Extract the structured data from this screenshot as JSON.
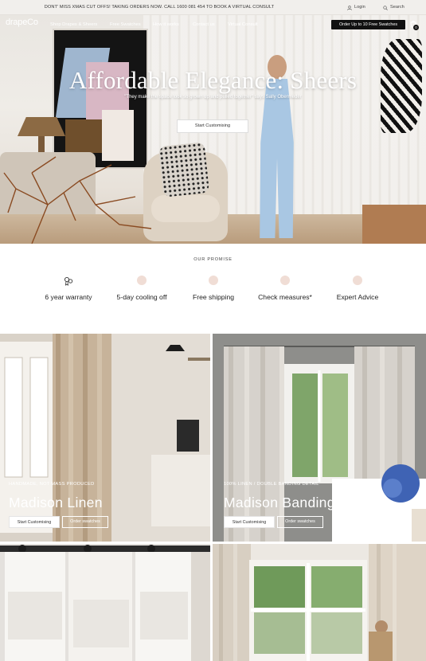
{
  "announcement": {
    "message": "DONT' MISS XMAS CUT OFFS! TAKING ORDERS NOW. CALL 1600 081 454 TO BOOK A VIRTUAL CONSULT",
    "login_label": "Login",
    "search_label": "Search"
  },
  "nav": {
    "logo": "drapeCo",
    "links": [
      "Shop Drapes & Sheers",
      "Free Swatches",
      "How it works",
      "Contact us",
      "Virtual Consult"
    ],
    "cta": "Order Up to 10 Free Swatches",
    "cart_count": "0"
  },
  "hero": {
    "title": "Affordable Elegance: Sheers",
    "quote": "\"They make the space look so grown up and pulled together\" says Sally Obermeder",
    "button": "Start Customising"
  },
  "promise": {
    "heading": "OUR PROMISE",
    "items": [
      {
        "label": "6 year warranty",
        "icon": "badge-icon"
      },
      {
        "label": "5-day cooling off",
        "icon": "cooling-off-icon"
      },
      {
        "label": "Free shipping",
        "icon": "shipping-icon"
      },
      {
        "label": "Check measures*",
        "icon": "measure-icon"
      },
      {
        "label": "Expert Advice",
        "icon": "advice-icon"
      }
    ]
  },
  "products": [
    {
      "eyebrow": "HANDMADE, NOT MASS PRODUCED",
      "name": "Madison Linen",
      "primary_button": "Start Customising",
      "secondary_button": "Order swatches"
    },
    {
      "eyebrow": "100% LINEN / DOUBLE BANDING DETAIL",
      "name": "Madison Banding",
      "primary_button": "Start Customising",
      "secondary_button": "Order swatches"
    }
  ],
  "colors": {
    "announcement_bg": "#f1efec",
    "cta_bg": "#111111",
    "promise_icon": "#f0ddd5",
    "text_on_image": "#ffffff"
  }
}
